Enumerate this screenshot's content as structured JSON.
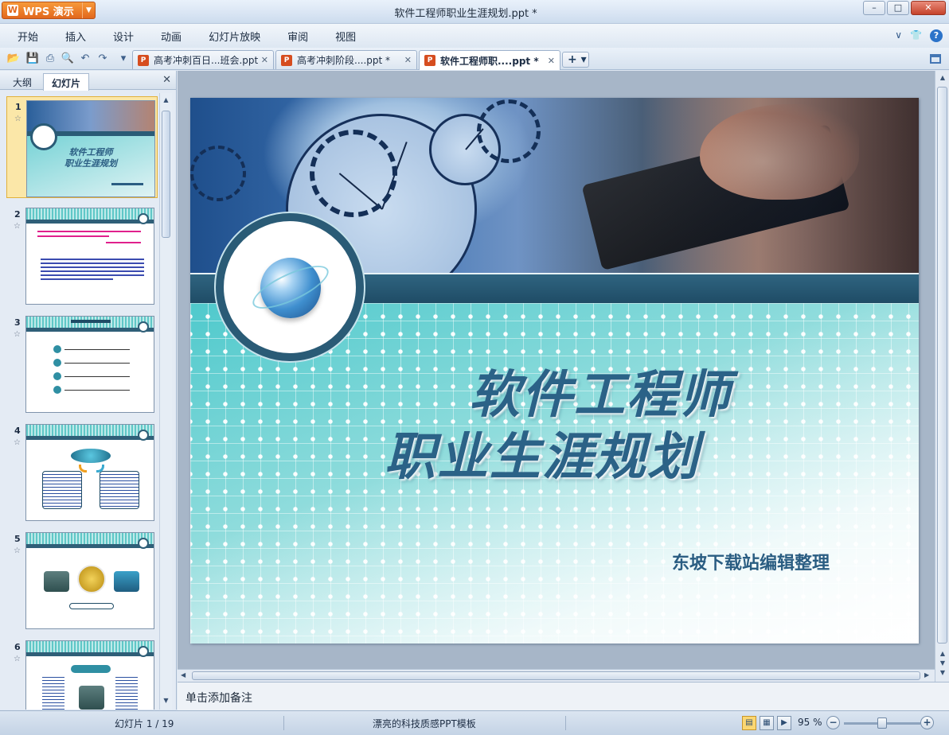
{
  "window": {
    "app_name": "WPS 演示",
    "app_logo": "W",
    "title": "软件工程师职业生涯规划.ppt *",
    "controls": [
      "–",
      "□",
      "✕"
    ]
  },
  "menu": [
    "开始",
    "插入",
    "设计",
    "动画",
    "幻灯片放映",
    "审阅",
    "视图"
  ],
  "menu_right": {
    "collapse": "∨",
    "skin": "👕",
    "help": "?"
  },
  "doc_tabs": [
    {
      "label": "高考冲刺百日...班会.ppt",
      "close": "✕",
      "active": false
    },
    {
      "label": "高考冲刺阶段....ppt *",
      "close": "✕",
      "active": false
    },
    {
      "label": "软件工程师职....ppt *",
      "close": "✕",
      "active": true
    }
  ],
  "new_tab": "+ ▾",
  "side": {
    "tabs": [
      "大纲",
      "幻灯片"
    ],
    "active_tab": "幻灯片",
    "close": "✕",
    "thumbs": [
      {
        "num": "1",
        "title_line1": "软件工程师",
        "title_line2": "职业生涯规划",
        "selected": true
      },
      {
        "num": "2",
        "selected": false
      },
      {
        "num": "3",
        "selected": false
      },
      {
        "num": "4",
        "selected": false
      },
      {
        "num": "5",
        "selected": false
      },
      {
        "num": "6",
        "selected": false
      }
    ],
    "star": "☆"
  },
  "slide": {
    "title_line1": "软件工程师",
    "title_line2": "职业生涯规划",
    "subtitle": "东坡下载站编辑整理",
    "accent": "#2b6287"
  },
  "notes_placeholder": "单击添加备注",
  "status": {
    "slide_count": "幻灯片 1 / 19",
    "template": "漂亮的科技质感PPT模板",
    "zoom": "95 %",
    "zoom_level": 0.5
  }
}
